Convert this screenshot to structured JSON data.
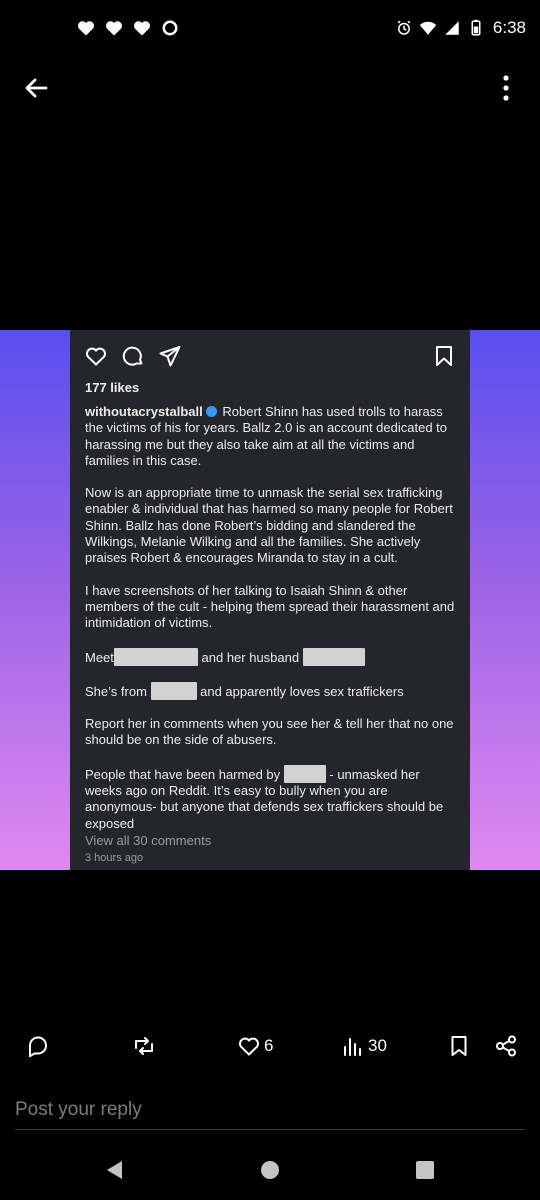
{
  "status": {
    "time": "6:38"
  },
  "post": {
    "likes": "177 likes",
    "username": "withoutacrystalball",
    "caption_intro": " Robert Shinn has used trolls to harass the victims of his for years. Ballz 2.0 is an account dedicated to harassing me but they also take aim at all the victims and families in this case.",
    "p2": "Now is an appropriate time to unmask the serial sex trafficking enabler & individual that has harmed so many people for Robert Shinn. Ballz has done Robert’s bidding and slandered the Wilkings, Melanie Wilking and all the families. She actively praises Robert & encourages Miranda to stay in a cult.",
    "p3": "I have screenshots of her talking to Isaiah Shinn & other members of the cult - helping them spread their harassment and intimidation of victims.",
    "p4a": "Meet",
    "p4b": " and her husband ",
    "p5a": "She’s from ",
    "p5b": " and apparently loves sex traffickers",
    "p6": "Report her in comments when you see her & tell her that no one should be on the side of abusers.",
    "p7a": "People that have been harmed by ",
    "p7b": " - unmasked her weeks ago on Reddit. It’s easy to bully when you are anonymous- but anyone that defends sex traffickers should be exposed",
    "view_comments": "View all 30 comments",
    "time_ago": "3 hours ago"
  },
  "actions": {
    "likes_count": "6",
    "views_count": "30"
  },
  "reply": {
    "placeholder": "Post your reply"
  }
}
